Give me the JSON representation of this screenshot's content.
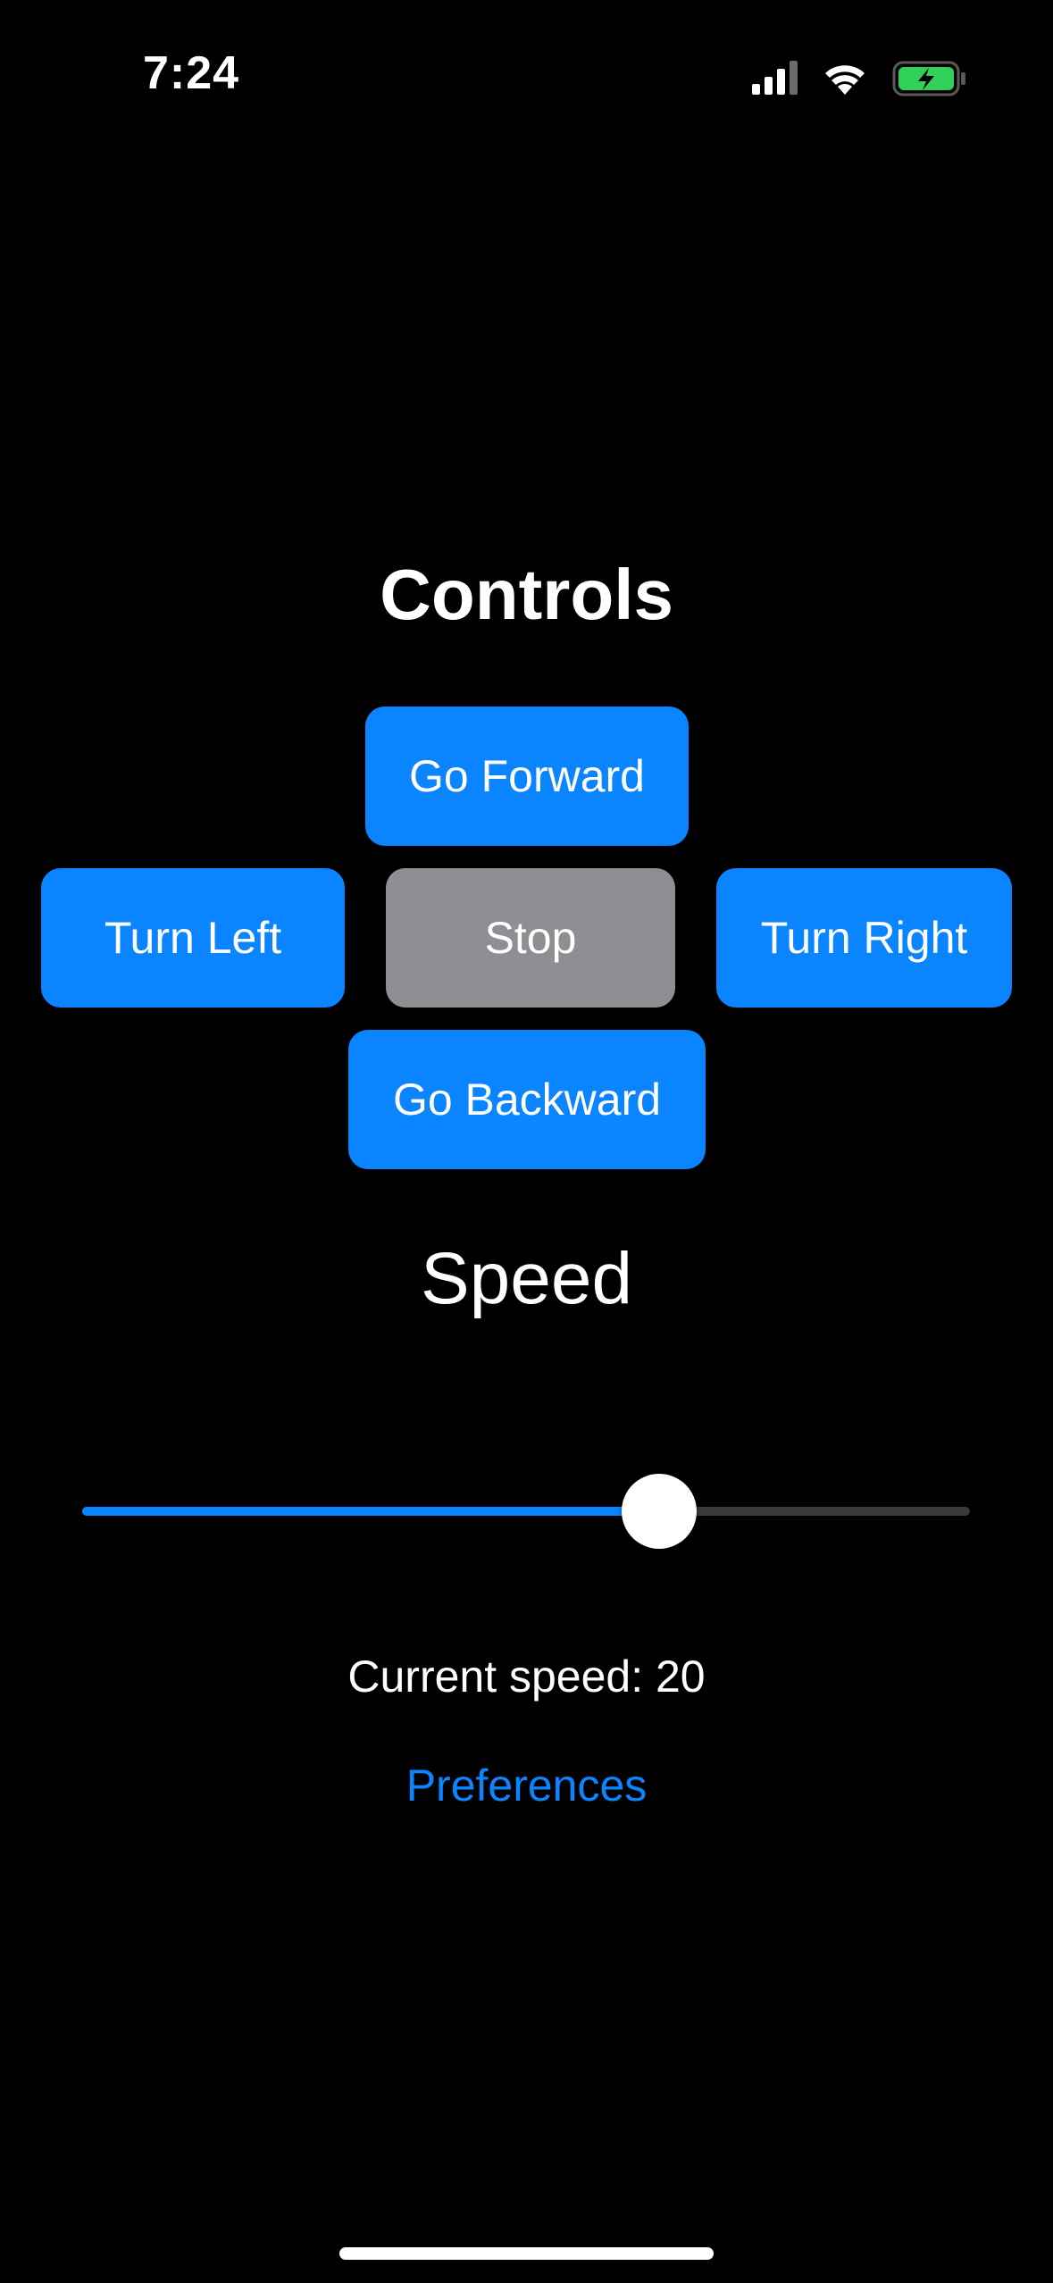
{
  "status_bar": {
    "time": "7:24",
    "icons": [
      "cellular-signal-icon",
      "wifi-icon",
      "battery-charging-icon"
    ],
    "battery_color": "#30d158"
  },
  "main": {
    "title": "Controls",
    "buttons": {
      "forward": "Go Forward",
      "left": "Turn Left",
      "stop": "Stop",
      "right": "Turn Right",
      "backward": "Go Backward"
    },
    "speed_label": "Speed",
    "speed_slider": {
      "value_fraction": 0.65
    },
    "current_speed_text": "Current speed: 20",
    "preferences_link": "Preferences"
  },
  "colors": {
    "background": "#000000",
    "accent": "#0a84ff",
    "stop_button": "#8e8e93",
    "slider_track": "#3a3a3c"
  }
}
